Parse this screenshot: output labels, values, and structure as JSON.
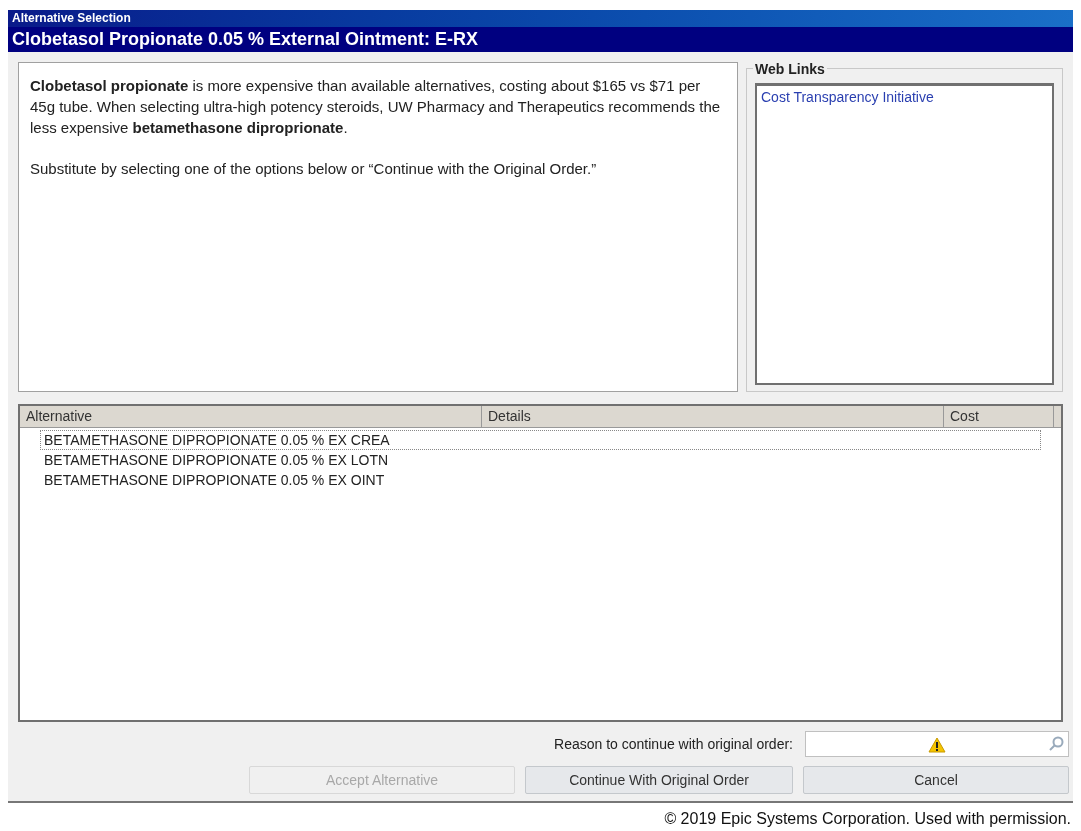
{
  "window": {
    "title": "Alternative Selection",
    "heading": "Clobetasol Propionate 0.05 % External Ointment: E-RX"
  },
  "message": {
    "paragraphs": [
      "**Clobetasol propionate** is more expensive than available alternatives, costing about $165 vs $71 per 45g tube. When selecting ultra-high potency steroids, UW Pharmacy and Therapeutics recommends the less expensive **betamethasone diproprionate**.",
      "Substitute by selecting one of the options below or “Continue with the Original Order.”"
    ]
  },
  "web_links": {
    "title": "Web Links",
    "links": [
      "Cost Transparency Initiative"
    ]
  },
  "table": {
    "columns": [
      "Alternative",
      "Details",
      "Cost"
    ],
    "rows": [
      {
        "alternative": "BETAMETHASONE DIPROPIONATE 0.05 % EX CREA",
        "selected": true
      },
      {
        "alternative": "BETAMETHASONE DIPROPIONATE 0.05 % EX LOTN",
        "selected": false
      },
      {
        "alternative": "BETAMETHASONE DIPROPIONATE 0.05 % EX OINT",
        "selected": false
      }
    ]
  },
  "reason": {
    "label": "Reason to continue with original order:",
    "required": true
  },
  "buttons": [
    {
      "label": "Accept Alternative",
      "disabled": true
    },
    {
      "label": "Continue With Original Order",
      "disabled": false
    },
    {
      "label": "Cancel",
      "disabled": false
    }
  ],
  "footer": "© 2019 Epic Systems Corporation. Used with permission."
}
